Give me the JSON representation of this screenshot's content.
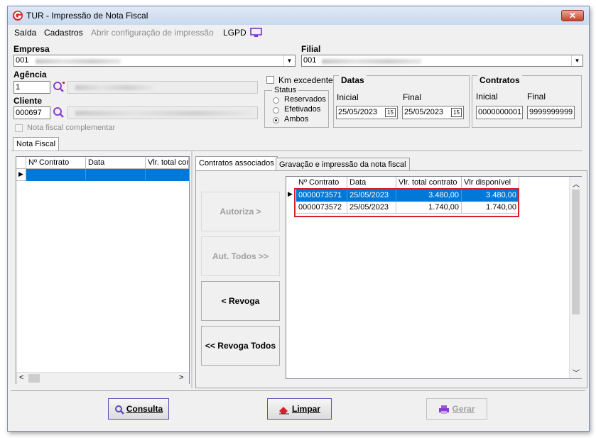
{
  "window": {
    "title": "TUR - Impressão de Nota Fiscal",
    "close": "✕"
  },
  "menu": {
    "items": [
      "Saída",
      "Cadastros",
      "Abrir configuração de impressão",
      "LGPD"
    ]
  },
  "empresa": {
    "label": "Empresa",
    "value": "001"
  },
  "filial": {
    "label": "Filial",
    "value": "001"
  },
  "agencia": {
    "label": "Agência",
    "value": "1"
  },
  "cliente": {
    "label": "Cliente",
    "value": "000697"
  },
  "km_excedente": {
    "label": "Km excedente"
  },
  "status": {
    "label": "Status",
    "options": [
      "Reservados",
      "Efetivados",
      "Ambos"
    ],
    "selected": "Ambos"
  },
  "nota_complementar": {
    "label": "Nota fiscal complementar"
  },
  "datas": {
    "title": "Datas",
    "inicial_label": "Inicial",
    "final_label": "Final",
    "inicial": "25/05/2023",
    "final": "25/05/2023",
    "cal": "15"
  },
  "contratos": {
    "title": "Contratos",
    "inicial_label": "Inicial",
    "final_label": "Final",
    "inicial": "0000000001",
    "final": "9999999999"
  },
  "left_tab": {
    "label": "Nota Fiscal"
  },
  "left_grid": {
    "columns": [
      "Nº Contrato",
      "Data",
      "Vlr. total con"
    ]
  },
  "right_tabs": {
    "tab1": "Contratos associados",
    "tab2": "Gravação e impressão da nota fiscal"
  },
  "contracts_grid": {
    "columns": [
      "Nº Contrato",
      "Data",
      "Vlr. total contrato",
      "Vlr disponível"
    ],
    "rows": [
      {
        "contrato": "0000073571",
        "data": "25/05/2023",
        "total": "3.480,00",
        "disponivel": "3.480,00"
      },
      {
        "contrato": "0000073572",
        "data": "25/05/2023",
        "total": "1.740,00",
        "disponivel": "1.740,00"
      }
    ]
  },
  "actions": {
    "autoriza": "Autoriza >",
    "aut_todos": "Aut. Todos >>",
    "revoga": "< Revoga",
    "revoga_todos": "<< Revoga Todos"
  },
  "footer": {
    "consulta": "Consulta",
    "limpar": "Limpar",
    "gerar": "Gerar"
  },
  "colors": {
    "selection": "#0078d7",
    "highlight": "#d8202a",
    "accent": "#7b2fbf"
  }
}
